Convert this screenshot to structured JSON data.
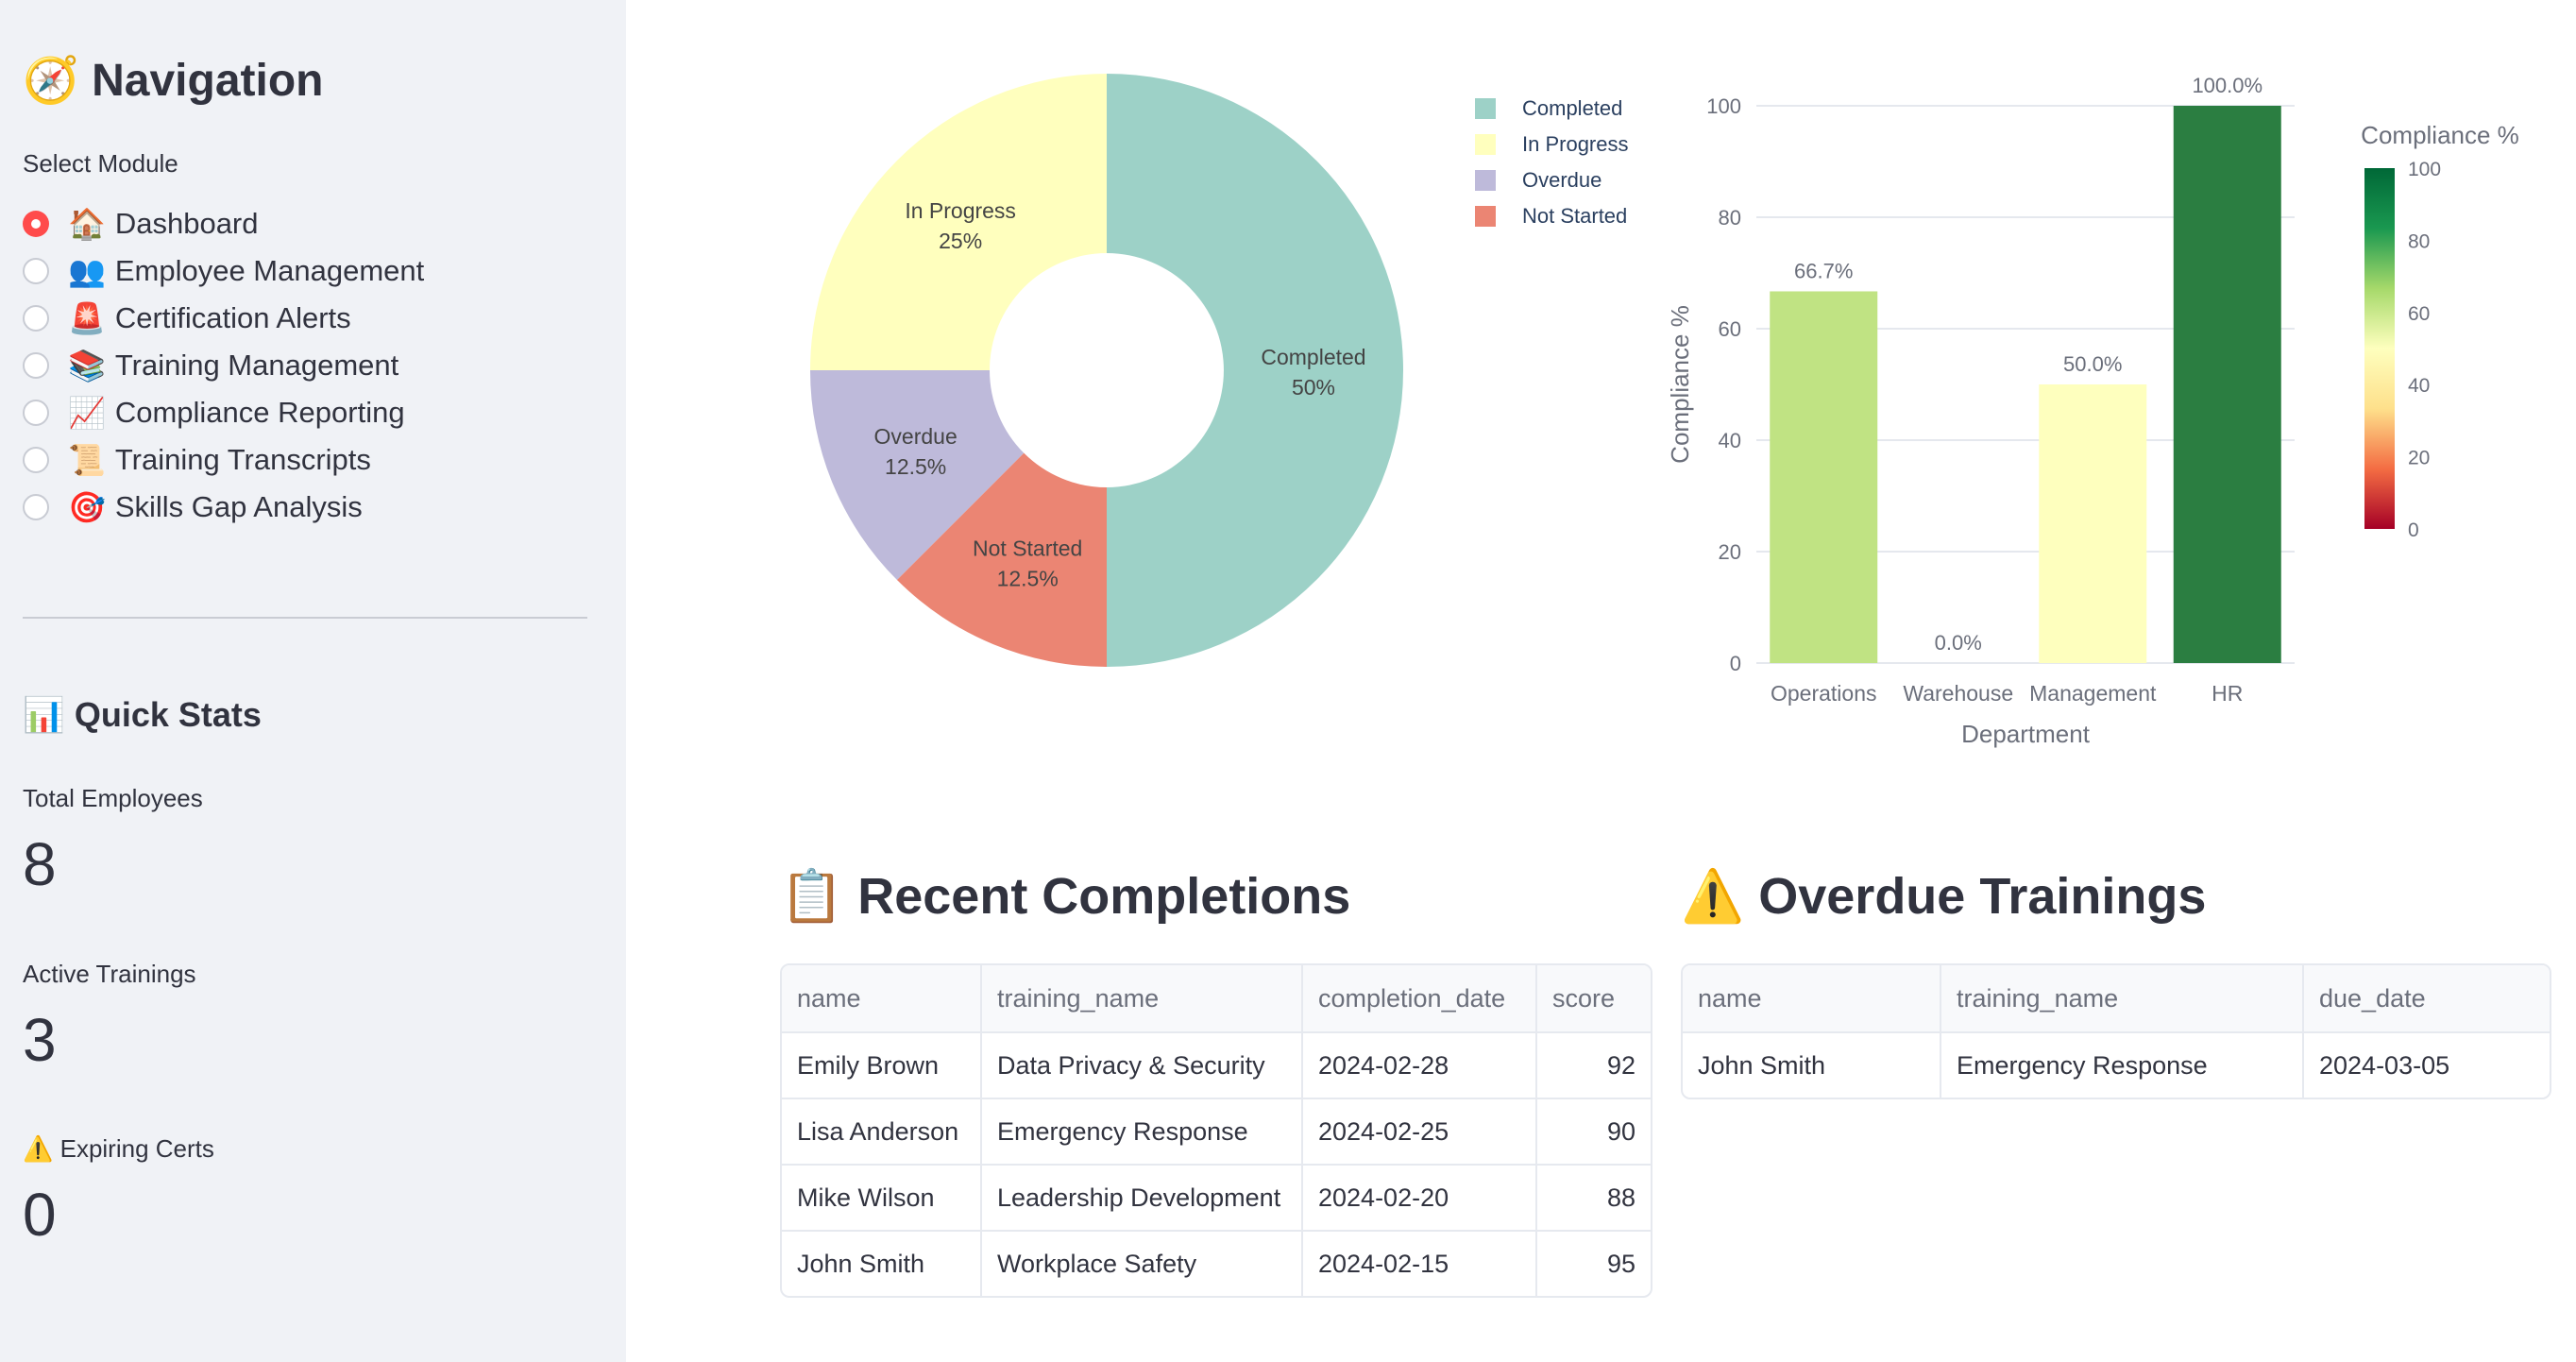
{
  "sidebar": {
    "title": "🧭 Navigation",
    "select_label": "Select Module",
    "modules": [
      {
        "icon": "🏠",
        "label": "Dashboard",
        "selected": true
      },
      {
        "icon": "👥",
        "label": "Employee Management",
        "selected": false
      },
      {
        "icon": "🚨",
        "label": "Certification Alerts",
        "selected": false
      },
      {
        "icon": "📚",
        "label": "Training Management",
        "selected": false
      },
      {
        "icon": "📈",
        "label": "Compliance Reporting",
        "selected": false
      },
      {
        "icon": "📜",
        "label": "Training Transcripts",
        "selected": false
      },
      {
        "icon": "🎯",
        "label": "Skills Gap Analysis",
        "selected": false
      }
    ],
    "quick_stats_title": "📊 Quick Stats",
    "metrics": [
      {
        "label": "Total Employees",
        "value": "8"
      },
      {
        "label": "Active Trainings",
        "value": "3"
      },
      {
        "label": "⚠️ Expiring Certs",
        "value": "0"
      }
    ]
  },
  "chart_data": [
    {
      "type": "pie",
      "hole": true,
      "labels": [
        "Completed",
        "In Progress",
        "Overdue",
        "Not Started"
      ],
      "values": [
        50,
        25,
        12.5,
        12.5
      ],
      "slice_labels": [
        "50%",
        "25%",
        "12.5%",
        "12.5%"
      ],
      "colors": [
        "#9dd1c7",
        "#ffffbe",
        "#bebada",
        "#eb8573"
      ],
      "legend": "right"
    },
    {
      "type": "bar",
      "categories": [
        "Operations",
        "Warehouse",
        "Management",
        "HR"
      ],
      "values": [
        66.7,
        0,
        50.0,
        100.0
      ],
      "data_labels": [
        "66.7%",
        "0.0%",
        "50.0%",
        "100.0%"
      ],
      "xlabel": "Department",
      "ylabel": "Compliance %",
      "ylim": [
        0,
        100
      ],
      "yticks": [
        0,
        20,
        40,
        60,
        80,
        100
      ],
      "colors": [
        "#c0e383",
        "#a50026",
        "#feffbe",
        "#2b7e41"
      ],
      "colorbar": {
        "title": "Compliance %",
        "ticks": [
          0,
          20,
          40,
          60,
          80,
          100
        ],
        "scale": [
          "#a50026",
          "#f46d43",
          "#fee08b",
          "#feffbe",
          "#a6d96a",
          "#1a9850",
          "#006837"
        ]
      },
      "grid": true
    }
  ],
  "recent": {
    "title": "📋 Recent Completions",
    "columns": [
      "name",
      "training_name",
      "completion_date",
      "score"
    ],
    "rows": [
      [
        "Emily Brown",
        "Data Privacy & Security",
        "2024-02-28",
        "92"
      ],
      [
        "Lisa Anderson",
        "Emergency Response",
        "2024-02-25",
        "90"
      ],
      [
        "Mike Wilson",
        "Leadership Development",
        "2024-02-20",
        "88"
      ],
      [
        "John Smith",
        "Workplace Safety",
        "2024-02-15",
        "95"
      ]
    ]
  },
  "overdue": {
    "title": "⚠️ Overdue Trainings",
    "columns": [
      "name",
      "training_name",
      "due_date"
    ],
    "rows": [
      [
        "John Smith",
        "Emergency Response",
        "2024-03-05"
      ]
    ]
  }
}
